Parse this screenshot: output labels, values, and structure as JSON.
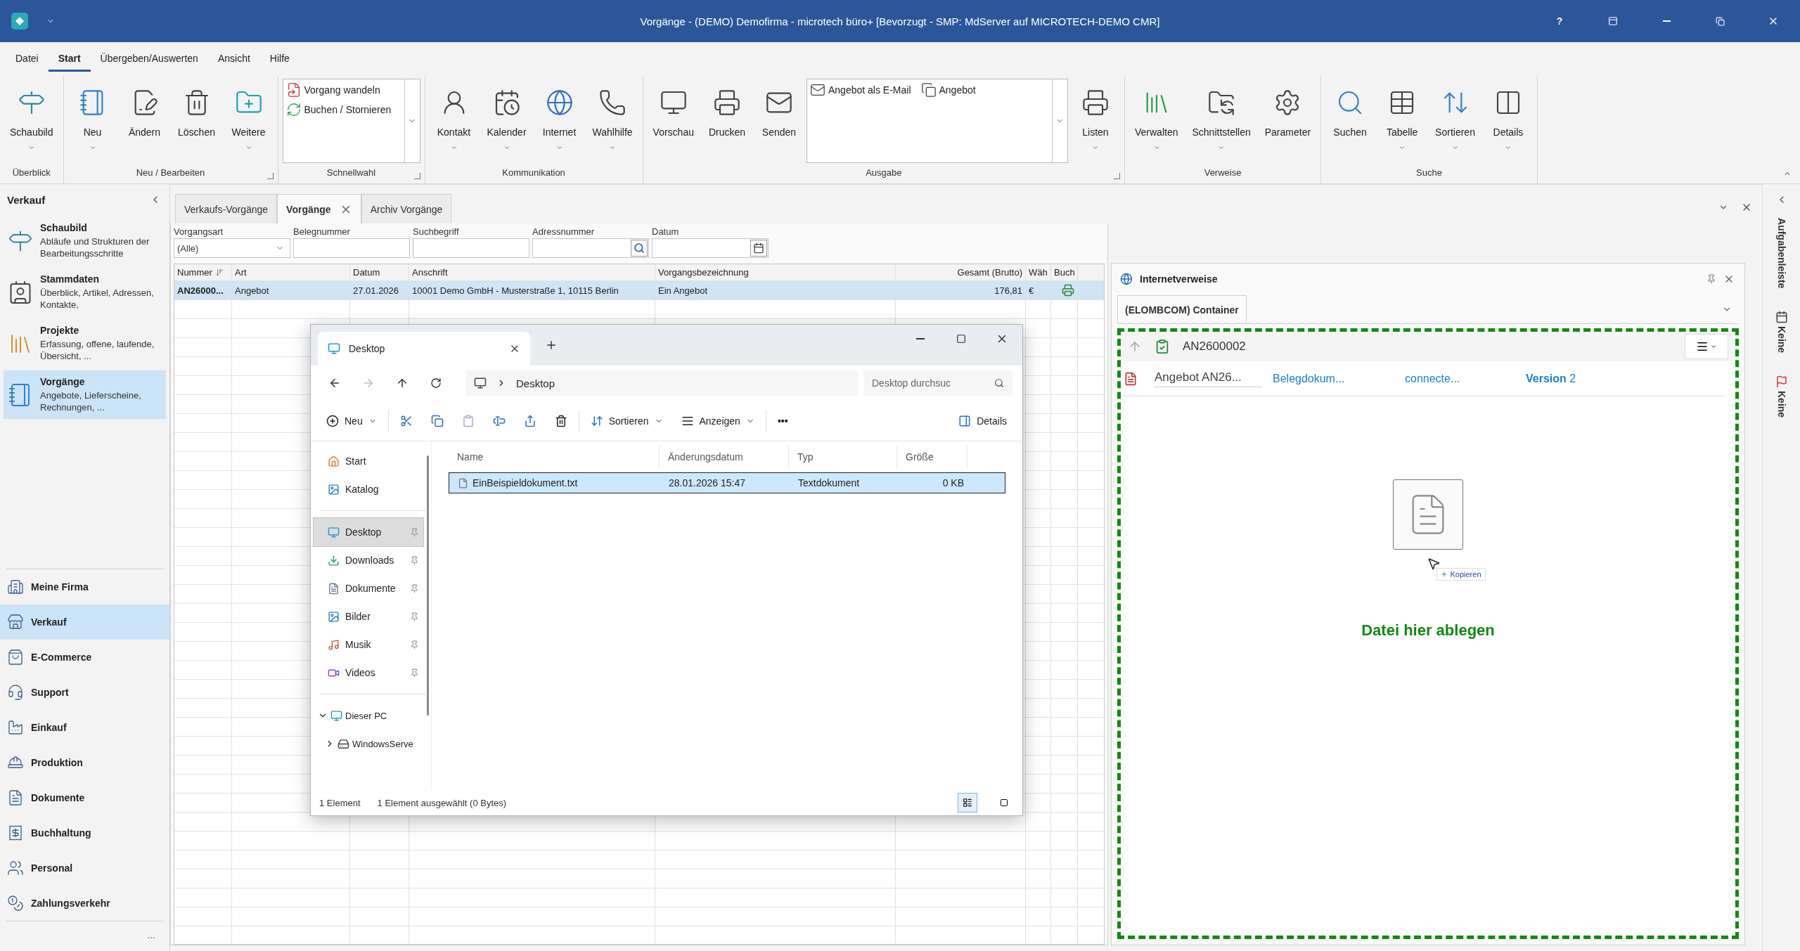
{
  "window": {
    "title": "Vorgänge - (DEMO) Demofirma - microtech büro+ [Bevorzugt - SMP: MdServer auf MICROTECH-DEMO CMR]",
    "help": "?"
  },
  "menu_tabs": [
    {
      "label": "Datei",
      "selected": false
    },
    {
      "label": "Start",
      "selected": true
    },
    {
      "label": "Übergeben/Auswerten",
      "selected": false
    },
    {
      "label": "Ansicht",
      "selected": false
    },
    {
      "label": "Hilfe",
      "selected": false
    }
  ],
  "ribbon_groups": [
    {
      "label": "Überblick",
      "items": [
        {
          "kind": "large",
          "label": "Schaubild",
          "dropdown": true
        }
      ]
    },
    {
      "label": "Neu / Bearbeiten",
      "launcher": true,
      "items": [
        {
          "kind": "large",
          "label": "Neu",
          "dropdown": true
        },
        {
          "kind": "large",
          "label": "Ändern",
          "dropdown": false
        },
        {
          "kind": "large",
          "label": "Löschen",
          "dropdown": false
        },
        {
          "kind": "large",
          "label": "Weitere",
          "dropdown": true
        }
      ]
    },
    {
      "label": "Schnellwahl",
      "launcher": true,
      "items": [
        {
          "kind": "gallery",
          "entries": [
            "Vorgang wandeln",
            "Buchen / Stornieren"
          ]
        }
      ]
    },
    {
      "label": "Kommunikation",
      "items": [
        {
          "kind": "large",
          "label": "Kontakt",
          "dropdown": true
        },
        {
          "kind": "large",
          "label": "Kalender",
          "dropdown": true
        },
        {
          "kind": "large",
          "label": "Internet",
          "dropdown": true
        },
        {
          "kind": "large",
          "label": "Wahlhilfe",
          "dropdown": true
        }
      ]
    },
    {
      "label": "Ausgabe",
      "launcher": true,
      "items": [
        {
          "kind": "large",
          "label": "Vorschau",
          "dropdown": false
        },
        {
          "kind": "large",
          "label": "Drucken",
          "dropdown": false
        },
        {
          "kind": "large",
          "label": "Senden",
          "dropdown": false
        },
        {
          "kind": "gallery",
          "entries": [
            "Angebot als E-Mail",
            "Angebot"
          ]
        },
        {
          "kind": "large",
          "label": "Listen",
          "dropdown": true
        }
      ]
    },
    {
      "label": "Verweise",
      "items": [
        {
          "kind": "large",
          "label": "Verwalten",
          "dropdown": true
        },
        {
          "kind": "large",
          "label": "Schnittstellen",
          "dropdown": true
        },
        {
          "kind": "large",
          "label": "Parameter",
          "dropdown": false
        }
      ]
    },
    {
      "label": "Suche",
      "items": [
        {
          "kind": "large",
          "label": "Suchen",
          "dropdown": false
        },
        {
          "kind": "large",
          "label": "Tabelle",
          "dropdown": true
        },
        {
          "kind": "large",
          "label": "Sortieren",
          "dropdown": true
        },
        {
          "kind": "large",
          "label": "Details",
          "dropdown": true
        }
      ]
    }
  ],
  "sidebar": {
    "title": "Verkauf",
    "modules": [
      {
        "title": "Schaubild",
        "description": "Abläufe und Strukturen der Bearbeitungsschritte",
        "selected": false
      },
      {
        "title": "Stammdaten",
        "description": "Überblick, Artikel, Adressen, Kontakte,",
        "selected": false
      },
      {
        "title": "Projekte",
        "description": "Erfassung, offene, laufende, Übersicht, ...",
        "selected": false
      },
      {
        "title": "Vorgänge",
        "description": "Angebote, Lieferscheine, Rechnungen, ...",
        "selected": true
      }
    ],
    "areas": [
      {
        "label": "Meine Firma",
        "selected": false
      },
      {
        "label": "Verkauf",
        "selected": true
      },
      {
        "label": "E-Commerce",
        "selected": false
      },
      {
        "label": "Support",
        "selected": false
      },
      {
        "label": "Einkauf",
        "selected": false
      },
      {
        "label": "Produktion",
        "selected": false
      },
      {
        "label": "Dokumente",
        "selected": false
      },
      {
        "label": "Buchhaltung",
        "selected": false
      },
      {
        "label": "Personal",
        "selected": false
      },
      {
        "label": "Zahlungsverkehr",
        "selected": false
      }
    ],
    "more": "..."
  },
  "document_tabs": [
    {
      "label": "Verkaufs-Vorgänge",
      "selected": false
    },
    {
      "label": "Vorgänge",
      "selected": true
    },
    {
      "label": "Archiv Vorgänge",
      "selected": false
    }
  ],
  "filters": [
    {
      "kind": "select",
      "label": "Vorgangsart",
      "value": "(Alle)"
    },
    {
      "kind": "text",
      "label": "Belegnummer"
    },
    {
      "kind": "text",
      "label": "Suchbegriff"
    },
    {
      "kind": "search",
      "label": "Adressnummer"
    },
    {
      "kind": "date",
      "label": "Datum"
    }
  ],
  "table": {
    "columns": [
      "Nummer",
      "Art",
      "Datum",
      "Anschrift",
      "Vorgangsbezeichnung",
      "Gesamt (Brutto)",
      "Wäh",
      "Buch"
    ],
    "rows": [
      {
        "selected": true,
        "printed": true,
        "cells": [
          "AN26000...",
          "Angebot",
          "27.01.2026",
          "10001  Demo GmbH - Musterstraße 1, 10115 Berlin",
          "Ein Angebot",
          "176,81",
          "€"
        ]
      }
    ]
  },
  "explorer": {
    "tab": "Desktop",
    "address": "Desktop",
    "search": {
      "placeholder": "Desktop durchsuc"
    },
    "toolbar": {
      "new": "Neu",
      "sort": "Sortieren",
      "view": "Anzeigen",
      "more": "•••",
      "details": "Details"
    },
    "nav_groups": [
      [
        {
          "label": "Start",
          "selected": false,
          "pinned": false
        },
        {
          "label": "Katalog",
          "selected": false,
          "pinned": false
        }
      ],
      [
        {
          "label": "Desktop",
          "selected": true,
          "pinned": true
        },
        {
          "label": "Downloads",
          "selected": false,
          "pinned": true
        },
        {
          "label": "Dokumente",
          "selected": false,
          "pinned": true
        },
        {
          "label": "Bilder",
          "selected": false,
          "pinned": true
        },
        {
          "label": "Musik",
          "selected": false,
          "pinned": true
        },
        {
          "label": "Videos",
          "selected": false,
          "pinned": true
        }
      ]
    ],
    "tree": [
      {
        "label": "Dieser PC",
        "expanded": true,
        "children": [
          {
            "label": "WindowsServe",
            "expanded": false
          }
        ]
      }
    ],
    "columns": [
      "Name",
      "Änderungsdatum",
      "Typ",
      "Größe"
    ],
    "files": [
      {
        "selected": true,
        "cells": [
          "EinBeispieldokument.txt",
          "28.01.2026 15:47",
          "Textdokument",
          "0 KB"
        ]
      }
    ],
    "status": [
      "1 Element",
      "1 Element ausgewählt (0 Bytes)"
    ],
    "views": [
      {
        "selected": true
      },
      {
        "selected": false
      }
    ]
  },
  "links_panel": {
    "title": "Internetverweise",
    "tabs": [
      {
        "label": "(ELOMBCOM) Container",
        "selected": true
      }
    ],
    "container": "AN2600002",
    "documents": [
      {
        "name": "Angebot AN26...",
        "category": "Belegdokum...",
        "source": "connecte...",
        "version": "**Version** 2"
      }
    ],
    "drag_hint": "Kopieren",
    "drop_text": "Datei hier ablegen"
  },
  "task_bar": {
    "title": "Aufgabenleiste",
    "items": [
      "Keine",
      "Keine"
    ]
  }
}
